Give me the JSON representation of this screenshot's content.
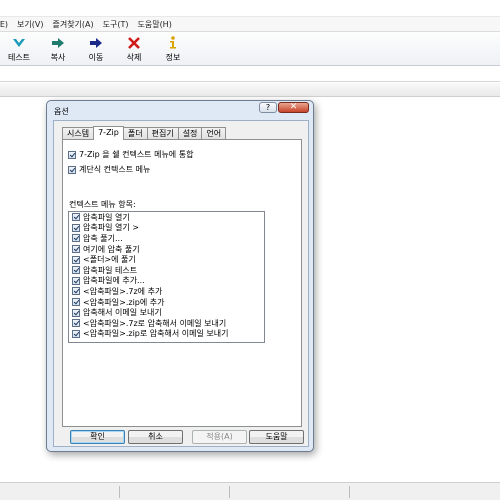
{
  "menubar": {
    "items": [
      "편집(E)",
      "보기(V)",
      "즐겨찾기(A)",
      "도구(T)",
      "도움말(H)"
    ]
  },
  "toolbar": {
    "buttons": [
      {
        "label": "테스트",
        "icon": "check-test-icon",
        "color": "#1a9bb8"
      },
      {
        "label": "복사",
        "icon": "copy-arrow-icon",
        "color": "#1f7b6e"
      },
      {
        "label": "이동",
        "icon": "move-arrow-icon",
        "color": "#1b2a8a"
      },
      {
        "label": "삭제",
        "icon": "delete-x-icon",
        "color": "#d01818"
      },
      {
        "label": "정보",
        "icon": "info-icon",
        "color": "#d9a400"
      }
    ]
  },
  "dialog": {
    "title": "옵션",
    "help_label": "?",
    "close_label": "✕",
    "tabs": [
      "시스템",
      "7-Zip",
      "폴더",
      "편집기",
      "설정",
      "언어"
    ],
    "active_tab": "7-Zip",
    "options": [
      {
        "label": "7-Zip 을 쉘 컨텍스트 메뉴에 통합",
        "checked": true
      },
      {
        "label": "계단식 컨텍스트 메뉴",
        "checked": true
      }
    ],
    "context_menu_label": "컨텍스트 메뉴 항목:",
    "context_items": [
      {
        "label": "압축파일 열기",
        "checked": true
      },
      {
        "label": "압축파일 열기 >",
        "checked": true
      },
      {
        "label": "압축 풀기...",
        "checked": true
      },
      {
        "label": "여기에 압축 풀기",
        "checked": true
      },
      {
        "label": "<폴더>에 풀기",
        "checked": true
      },
      {
        "label": "압축파일 테스트",
        "checked": true
      },
      {
        "label": "압축파일에 추가...",
        "checked": true
      },
      {
        "label": "<압축파일>.7z에 추가",
        "checked": true
      },
      {
        "label": "<압축파일>.zip에 추가",
        "checked": true
      },
      {
        "label": "압축해서 이메일 보내기",
        "checked": true
      },
      {
        "label": "<압축파일>.7z로 압축해서 이메일 보내기",
        "checked": true
      },
      {
        "label": "<압축파일>.zip로 압축해서 이메일 보내기",
        "checked": true
      }
    ],
    "buttons": {
      "ok": "확인",
      "cancel": "취소",
      "apply": "적용(A)",
      "help": "도움말"
    }
  }
}
